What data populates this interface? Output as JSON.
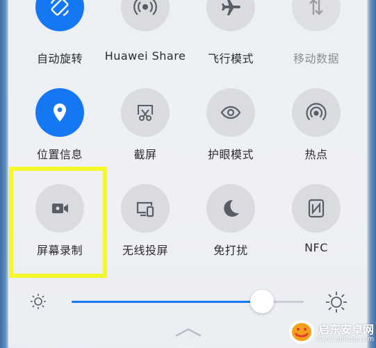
{
  "tiles": [
    {
      "label": "自动旋转",
      "icon": "auto-rotate-icon",
      "state": "on"
    },
    {
      "label": "Huawei Share",
      "icon": "huawei-share-icon",
      "state": "off"
    },
    {
      "label": "飞行模式",
      "icon": "airplane-icon",
      "state": "off"
    },
    {
      "label": "移动数据",
      "icon": "mobile-data-icon",
      "state": "disabled"
    },
    {
      "label": "位置信息",
      "icon": "location-icon",
      "state": "on"
    },
    {
      "label": "截屏",
      "icon": "screenshot-icon",
      "state": "off"
    },
    {
      "label": "护眼模式",
      "icon": "eye-icon",
      "state": "off"
    },
    {
      "label": "热点",
      "icon": "hotspot-icon",
      "state": "off"
    },
    {
      "label": "屏幕录制",
      "icon": "screen-record-icon",
      "state": "off"
    },
    {
      "label": "无线投屏",
      "icon": "wireless-projection-icon",
      "state": "off"
    },
    {
      "label": "免打扰",
      "icon": "moon-icon",
      "state": "off"
    },
    {
      "label": "NFC",
      "icon": "nfc-icon",
      "state": "off"
    }
  ],
  "brightness": {
    "level": 0.82,
    "low_icon": "brightness-low-icon",
    "high_icon": "brightness-high-icon"
  },
  "watermark": {
    "name": "启东安卓网",
    "url": "www.qdltdq.com"
  },
  "colors": {
    "accent": "#1478f5",
    "highlight": "#f4f72a",
    "tile_off": "#d9dbe0"
  }
}
